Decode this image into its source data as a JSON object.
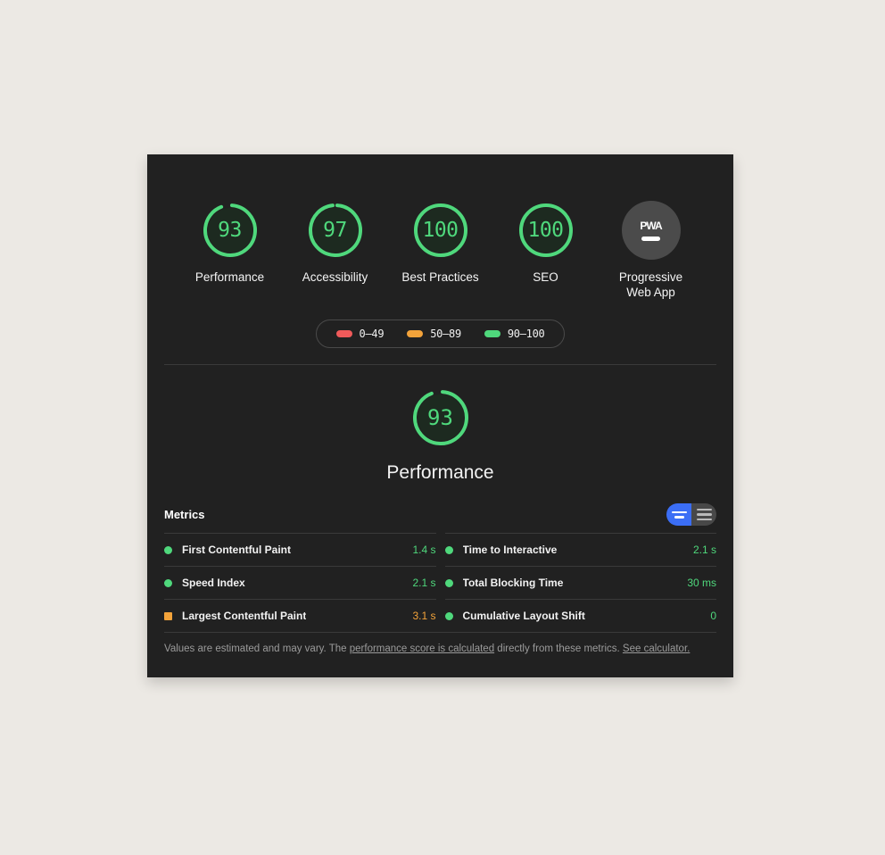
{
  "report": {
    "scores": [
      {
        "id": "performance",
        "score": 93,
        "label": "Performance",
        "rating": "pass",
        "display": "93",
        "arc": 93
      },
      {
        "id": "accessibility",
        "score": 97,
        "label": "Accessibility",
        "rating": "pass",
        "display": "97",
        "arc": 97
      },
      {
        "id": "best-practices",
        "score": 100,
        "label": "Best Practices",
        "rating": "pass",
        "display": "100",
        "arc": 100
      },
      {
        "id": "seo",
        "score": 100,
        "label": "SEO",
        "rating": "pass",
        "display": "100",
        "arc": 100
      },
      {
        "id": "pwa",
        "score": null,
        "label": "Progressive Web App",
        "rating": "none",
        "display": "PWA",
        "arc": 0
      }
    ],
    "legend": {
      "items": [
        {
          "range": "0–49",
          "rating": "fail",
          "color": "#f05a5a",
          "icon": "triangle-swatch"
        },
        {
          "range": "50–89",
          "rating": "average",
          "color": "#f3a33a",
          "icon": "square-swatch"
        },
        {
          "range": "90–100",
          "rating": "pass",
          "color": "#4fd87c",
          "icon": "circle-swatch"
        }
      ]
    },
    "hero": {
      "score": 93,
      "display": "93",
      "title": "Performance",
      "rating": "pass"
    },
    "metrics": {
      "title": "Metrics",
      "toggle": {
        "active_option": "simple",
        "options": [
          {
            "id": "simple",
            "icon": "bars-left-icon"
          },
          {
            "id": "detailed",
            "icon": "bars-full-icon"
          }
        ]
      },
      "column_left": [
        {
          "name": "First Contentful Paint",
          "value": "1.4 s",
          "rating": "pass"
        },
        {
          "name": "Speed Index",
          "value": "2.1 s",
          "rating": "pass"
        },
        {
          "name": "Largest Contentful Paint",
          "value": "3.1 s",
          "rating": "average"
        }
      ],
      "column_right": [
        {
          "name": "Time to Interactive",
          "value": "2.1 s",
          "rating": "pass"
        },
        {
          "name": "Total Blocking Time",
          "value": "30 ms",
          "rating": "pass"
        },
        {
          "name": "Cumulative Layout Shift",
          "value": "0",
          "rating": "pass"
        }
      ],
      "footer": {
        "part1": "Values are estimated and may vary. The ",
        "link1": "performance score is calculated",
        "part2": " directly from these metrics. ",
        "link2": "See calculator."
      }
    },
    "colors": {
      "pass": "#4fd87c",
      "average": "#f3a33a",
      "fail": "#f05a5a",
      "accent": "#3b6ef5",
      "card_background": "#212121",
      "page_background": "#ece9e4"
    }
  }
}
